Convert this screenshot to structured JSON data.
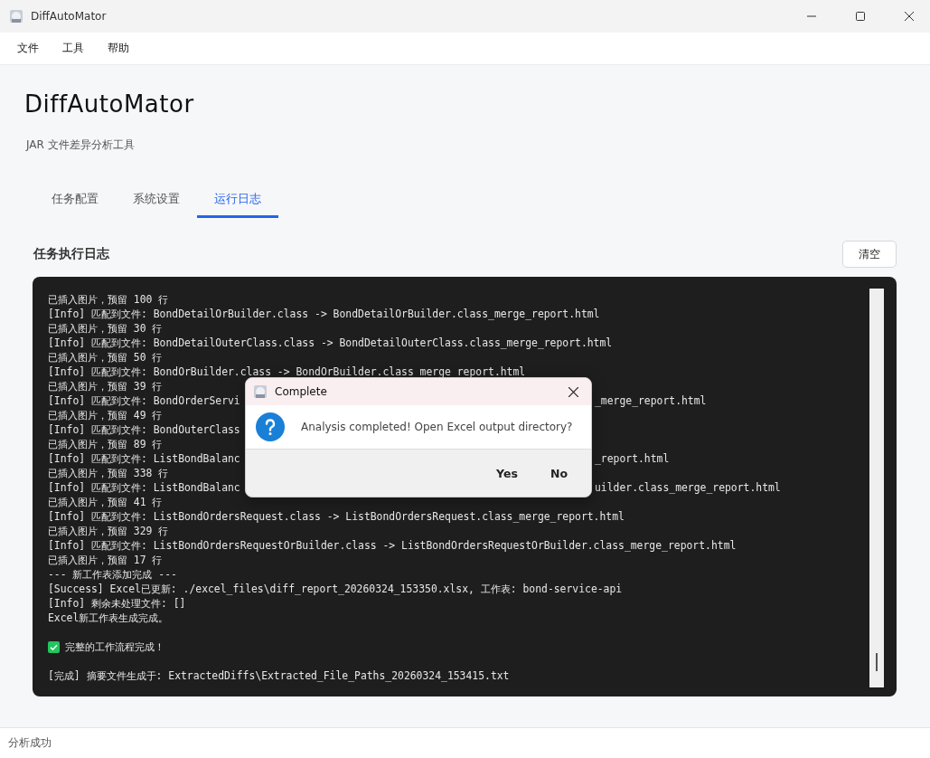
{
  "window": {
    "title": "DiffAutoMator"
  },
  "menu": [
    "文件",
    "工具",
    "帮助"
  ],
  "app_title": "DiffAutoMator",
  "subtitle": "JAR 文件差异分析工具",
  "tabs": [
    {
      "label": "任务配置",
      "selected": false
    },
    {
      "label": "系统设置",
      "selected": false
    },
    {
      "label": "运行日志",
      "selected": true
    }
  ],
  "log_section": {
    "heading": "任务执行日志",
    "clear_button": "清空"
  },
  "log_lines": [
    {
      "kind": "text",
      "text": "已插入图片，预留 100 行"
    },
    {
      "kind": "text",
      "text": "[Info] 匹配到文件: BondDetailOrBuilder.class -> BondDetailOrBuilder.class_merge_report.html"
    },
    {
      "kind": "text",
      "text": "已插入图片，预留 30 行"
    },
    {
      "kind": "text",
      "text": "[Info] 匹配到文件: BondDetailOuterClass.class -> BondDetailOuterClass.class_merge_report.html"
    },
    {
      "kind": "text",
      "text": "已插入图片，预留 50 行"
    },
    {
      "kind": "text",
      "text": "[Info] 匹配到文件: BondOrBuilder.class -> BondOrBuilder.class_merge_report.html"
    },
    {
      "kind": "text",
      "text": "已插入图片，预留 39 行"
    },
    {
      "kind": "split",
      "left": "[Info] 匹配到文件: BondOrderServi",
      "right": "_merge_report.html"
    },
    {
      "kind": "text",
      "text": "已插入图片，预留 49 行"
    },
    {
      "kind": "text",
      "text": "[Info] 匹配到文件: BondOuterClass"
    },
    {
      "kind": "text",
      "text": "已插入图片，预留 89 行"
    },
    {
      "kind": "split",
      "left": "[Info] 匹配到文件: ListBondBalanc",
      "right": "_report.html"
    },
    {
      "kind": "text",
      "text": "已插入图片，预留 338 行"
    },
    {
      "kind": "split",
      "left": "[Info] 匹配到文件: ListBondBalanc",
      "right": "uilder.class_merge_report.html"
    },
    {
      "kind": "text",
      "text": "已插入图片，预留 41 行"
    },
    {
      "kind": "text",
      "text": "[Info] 匹配到文件: ListBondOrdersRequest.class -> ListBondOrdersRequest.class_merge_report.html"
    },
    {
      "kind": "text",
      "text": "已插入图片，预留 329 行"
    },
    {
      "kind": "text",
      "text": "[Info] 匹配到文件: ListBondOrdersRequestOrBuilder.class -> ListBondOrdersRequestOrBuilder.class_merge_report.html"
    },
    {
      "kind": "text",
      "text": "已插入图片，预留 17 行"
    },
    {
      "kind": "text",
      "text": "--- 新工作表添加完成 ---"
    },
    {
      "kind": "text",
      "text": "[Success] Excel已更新: ./excel_files\\diff_report_20260324_153350.xlsx, 工作表: bond-service-api"
    },
    {
      "kind": "text",
      "text": "[Info] 剩余未处理文件: []"
    },
    {
      "kind": "text",
      "text": "Excel新工作表生成完成。"
    },
    {
      "kind": "blank"
    },
    {
      "kind": "check",
      "text": "完整的工作流程完成！"
    },
    {
      "kind": "blank"
    },
    {
      "kind": "text",
      "text": "[完成] 摘要文件生成于: ExtractedDiffs\\Extracted_File_Paths_20260324_153415.txt"
    }
  ],
  "dialog": {
    "title": "Complete",
    "message": "Analysis completed! Open Excel output directory?",
    "buttons": [
      "Yes",
      "No"
    ]
  },
  "status_bar": "分析成功"
}
